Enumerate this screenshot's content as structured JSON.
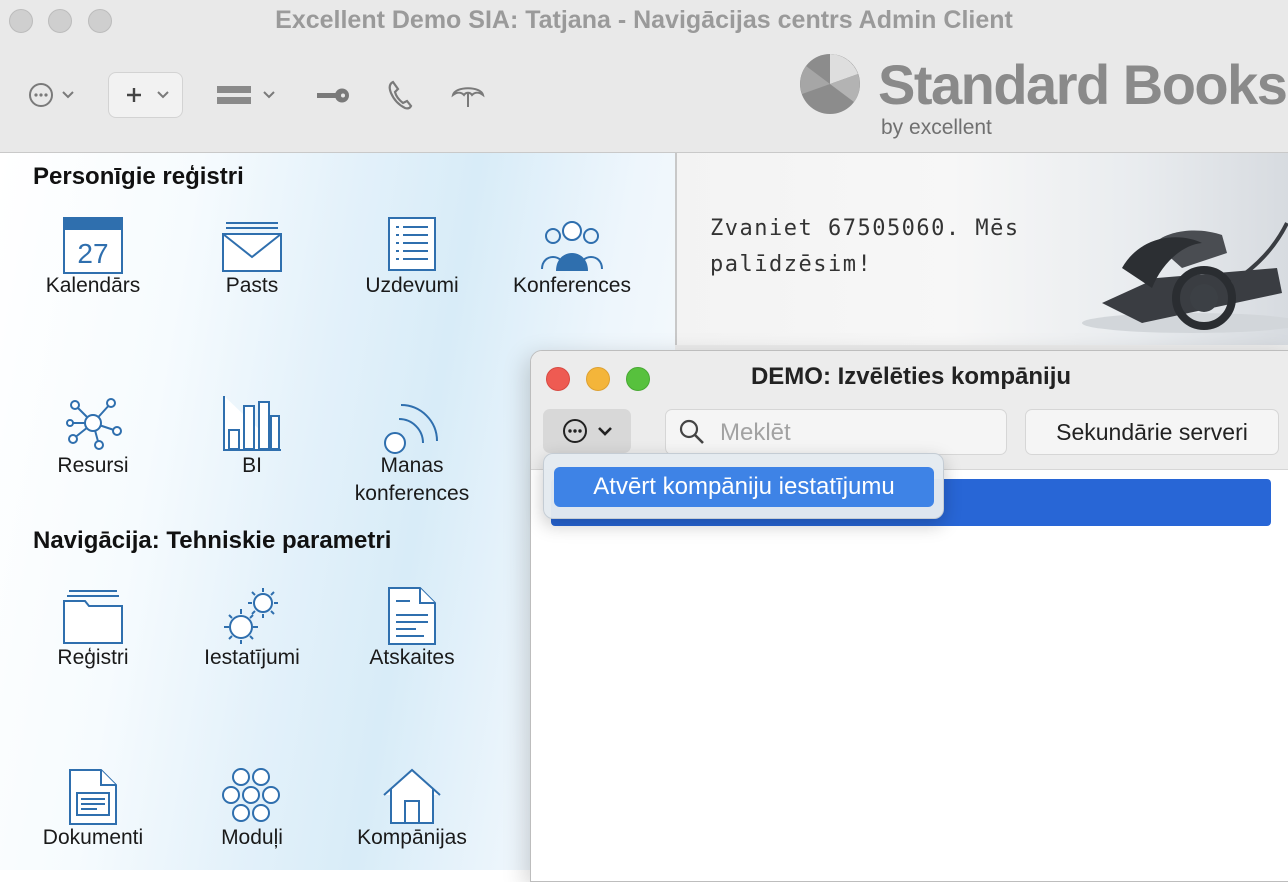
{
  "window": {
    "title": "Excellent Demo SIA: Tatjana - Navigācijas centrs Admin Client"
  },
  "toolbar": {
    "items": [
      {
        "name": "actions-menu",
        "icon": "ellipsis-circle-icon"
      },
      {
        "name": "new-menu",
        "icon": "plus-icon"
      },
      {
        "name": "view-menu",
        "icon": "bars-icon"
      },
      {
        "name": "key",
        "icon": "key-icon"
      },
      {
        "name": "phone",
        "icon": "phone-icon"
      },
      {
        "name": "umbrella",
        "icon": "umbrella-icon"
      }
    ]
  },
  "logo": {
    "name": "Standard Books",
    "sub": "by excellent"
  },
  "personal_registers": {
    "title": "Personīgie reģistri",
    "items": [
      {
        "label": "Kalendārs",
        "icon": "calendar-icon",
        "day": "27"
      },
      {
        "label": "Pasts",
        "icon": "mail-icon"
      },
      {
        "label": "Uzdevumi",
        "icon": "tasks-icon"
      },
      {
        "label": "Konferences",
        "icon": "conferences-icon"
      },
      {
        "label": "Resursi",
        "icon": "resources-icon"
      },
      {
        "label": "BI",
        "icon": "bi-chart-icon"
      },
      {
        "label": "Manas konferences",
        "icon": "my-conferences-icon"
      }
    ]
  },
  "technical_params": {
    "title": "Navigācija: Tehniskie parametri",
    "items": [
      {
        "label": "Reģistri",
        "icon": "registers-icon"
      },
      {
        "label": "Iestatījumi",
        "icon": "settings-gears-icon"
      },
      {
        "label": "Atskaites",
        "icon": "reports-icon"
      },
      {
        "label": "Dokumenti",
        "icon": "documents-icon"
      },
      {
        "label": "Moduļi",
        "icon": "modules-icon"
      },
      {
        "label": "Kompānijas",
        "icon": "companies-house-icon"
      }
    ]
  },
  "banner": {
    "text": "Zvaniet 67505060. Mēs palīdzēsim!"
  },
  "dialog": {
    "title": "DEMO: Izvēlēties kompāniju",
    "search_placeholder": "Meklēt",
    "secondary_servers_label": "Sekundārie serveri"
  },
  "popup_menu": {
    "items": [
      {
        "label": "Atvērt kompāniju iestatījumu",
        "highlighted": true
      }
    ]
  },
  "colors": {
    "icon_blue": "#2f6fae",
    "selection_blue": "#2866d6",
    "menu_highlight": "#3e83e6",
    "traffic_red": "#ee5b52",
    "traffic_yellow": "#f4b53a",
    "traffic_green": "#57c13d"
  }
}
